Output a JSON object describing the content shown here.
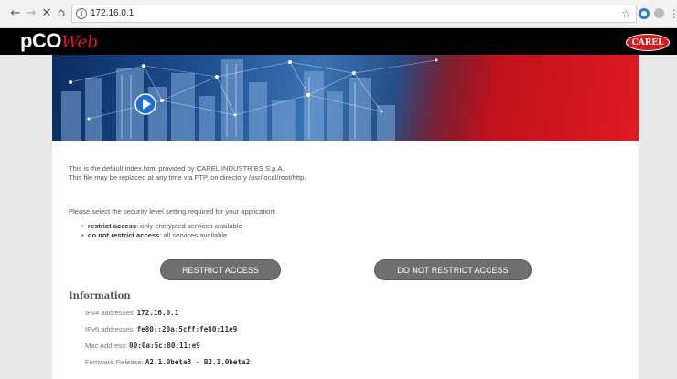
{
  "browser": {
    "url": "172.16.0.1",
    "icons": [
      "back-icon",
      "forward-icon",
      "stop-icon",
      "home-icon",
      "info-icon",
      "star-icon",
      "menu-icon"
    ]
  },
  "header": {
    "logo_part1": "pCO",
    "logo_part2": "Web",
    "brand_logo": "CAREL"
  },
  "intro": {
    "line1": "This is the default index.html provided by CAREL INDUSTRIES S.p.A.",
    "line2": "This file may be replaced at any time via FTP, on directory /usr/local/root/http."
  },
  "security": {
    "prompt": "Please select the security level setting required for your application:",
    "options": [
      {
        "term": "restrict access",
        "desc": ": only encrypted services available"
      },
      {
        "term": "do not restrict access",
        "desc": ": all services available"
      }
    ],
    "restrict_button": "RESTRICT ACCESS",
    "no_restrict_button": "DO NOT RESTRICT ACCESS"
  },
  "information": {
    "title": "Information",
    "rows": [
      {
        "label": "IPv4 addresses:",
        "value": "172.16.0.1"
      },
      {
        "label": "IPv6 addresses:",
        "value": "fe80::20a:5cff:fe80:11e9"
      },
      {
        "label": "Mac Address:",
        "value": "00:0a:5c:80:11:e9"
      },
      {
        "label": "Firmware Release:",
        "value": "A2.1.0beta3 - B2.1.0beta2"
      }
    ]
  },
  "colors": {
    "accent_red": "#d71920",
    "button_gray": "#6f6f6f",
    "header_black": "#000000"
  }
}
